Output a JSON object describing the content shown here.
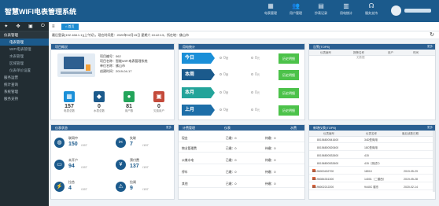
{
  "app": {
    "title": "智慧WIFI电表管理系统"
  },
  "topnav": [
    {
      "icon": "calendar-icon",
      "label": "电表管理"
    },
    {
      "icon": "users-icon",
      "label": "用户管理"
    },
    {
      "icon": "notebook-icon",
      "label": "抄表记录"
    },
    {
      "icon": "chart-icon",
      "label": "用电统计"
    },
    {
      "icon": "headset-icon",
      "label": "服务支持"
    }
  ],
  "sidebar": {
    "menu": [
      {
        "label": "仪表管理",
        "type": "group"
      },
      {
        "label": "电表管理",
        "type": "sub",
        "active": true
      },
      {
        "label": "WIFI电表管理",
        "type": "sub"
      },
      {
        "label": "水表管理",
        "type": "sub"
      },
      {
        "label": "区域管理",
        "type": "sub"
      },
      {
        "label": "仪表单价设置",
        "type": "sub"
      },
      {
        "label": "服务运营",
        "type": "collapsed"
      },
      {
        "label": "统计查询",
        "type": "collapsed"
      },
      {
        "label": "系统管理",
        "type": "collapsed"
      },
      {
        "label": "服务支持",
        "type": "collapsed"
      }
    ]
  },
  "tabs": {
    "home": "首页"
  },
  "infobar": {
    "text": "最后登录(192.168.1.1)(上午好)，现在时间是：2020年02月15日 星期六 10:42:13，所在地：佛山市"
  },
  "project": {
    "header": "项目概况",
    "lines": [
      "项目编号：062",
      "项目名称：智能WIFI电表管理系统",
      "单位名称：佛山市",
      "创建时间：2019-04-17"
    ]
  },
  "stats": [
    {
      "value": "157",
      "label": "电表总数",
      "color": "#1a8fd8",
      "icon": "meter-icon"
    },
    {
      "value": "0",
      "label": "水表总数",
      "color": "#1b5a8c",
      "icon": "drop-icon"
    },
    {
      "value": "81",
      "label": "用户数",
      "color": "#23a45a",
      "icon": "user-icon"
    },
    {
      "value": "0",
      "label": "欠费用户",
      "color": "#c44a3a",
      "icon": "alert-user-icon"
    }
  ],
  "consumption": {
    "header": "用电统计",
    "rows": [
      {
        "label": "今日",
        "color": "#1a8fd8",
        "a": "0",
        "a_unit": "度",
        "b": "0",
        "b_unit": "元",
        "hist": "历史明细"
      },
      {
        "label": "本周",
        "color": "#1b5a8c",
        "a": "0",
        "a_unit": "度",
        "b": "0",
        "b_unit": "元",
        "hist": "历史明细"
      },
      {
        "label": "本月",
        "color": "#23a49a",
        "a": "0",
        "a_unit": "度",
        "b": "0",
        "b_unit": "元",
        "hist": "历史明细"
      },
      {
        "label": "上月",
        "color": "#1d6ea8",
        "a": "0",
        "a_unit": "度",
        "b": "0",
        "b_unit": "元",
        "hist": "历史明细"
      }
    ]
  },
  "alarm": {
    "header": "告警(TOP8)",
    "more": "更多",
    "columns": [
      "仪表编号",
      "报警名称",
      "用户",
      "时间"
    ],
    "empty": "无数据"
  },
  "device_status": {
    "header": "仪表状态",
    "more": "更多",
    "items": [
      {
        "name": "联网中",
        "value": "150",
        "total": "/157",
        "icon": "globe-icon"
      },
      {
        "name": "失联",
        "value": "7",
        "total": "/157",
        "icon": "unlink-icon"
      },
      {
        "name": "未开户",
        "value": "94",
        "total": "/157",
        "icon": "card-icon"
      },
      {
        "name": "预付费",
        "value": "137",
        "total": "/157",
        "icon": "prepay-icon"
      },
      {
        "name": "拉合",
        "value": "4",
        "total": "/157",
        "icon": "switch-icon"
      },
      {
        "name": "拉闸",
        "value": "9",
        "total": "/157",
        "icon": "cut-icon"
      }
    ]
  },
  "billing": {
    "header": "计费管理",
    "center": "仪表",
    "right": "水费",
    "rows": [
      {
        "name": "现金",
        "a": "已缴：0",
        "b": "待缴：0"
      },
      {
        "name": "物业管理费",
        "a": "已缴：0",
        "b": "待缴：0"
      },
      {
        "name": "公摊水电",
        "a": "已缴：0",
        "b": "待缴：0"
      },
      {
        "name": "停车",
        "a": "已缴：0",
        "b": "待缴：0"
      },
      {
        "name": "其他",
        "a": "已缴：0",
        "b": "待缴：0"
      }
    ]
  },
  "new_devices": {
    "header": "新增仪表(TOP8)",
    "more": "更多",
    "columns": [
      "仪表编号",
      "仪表名称",
      "最后读数日期"
    ],
    "rows": [
      {
        "id": "80156800541600",
        "name": "34D型商用",
        "date": "",
        "tag": false
      },
      {
        "id": "80156800520600",
        "name": "18C型商用",
        "date": "",
        "tag": false
      },
      {
        "id": "80156800532600",
        "name": "415",
        "date": "",
        "tag": false
      },
      {
        "id": "80156800532600",
        "name": "415（测试2）",
        "date": "",
        "tag": false
      },
      {
        "id": "80196000432700",
        "name": "18010",
        "date": "2019-05-29",
        "tag": true
      },
      {
        "id": "80196084331300",
        "name": "14001（二楼西）",
        "date": "2019-05-28",
        "tag": true
      },
      {
        "id": "80196002212200",
        "name": "9440C 楼东",
        "date": "2020-02-14",
        "tag": true
      }
    ]
  }
}
